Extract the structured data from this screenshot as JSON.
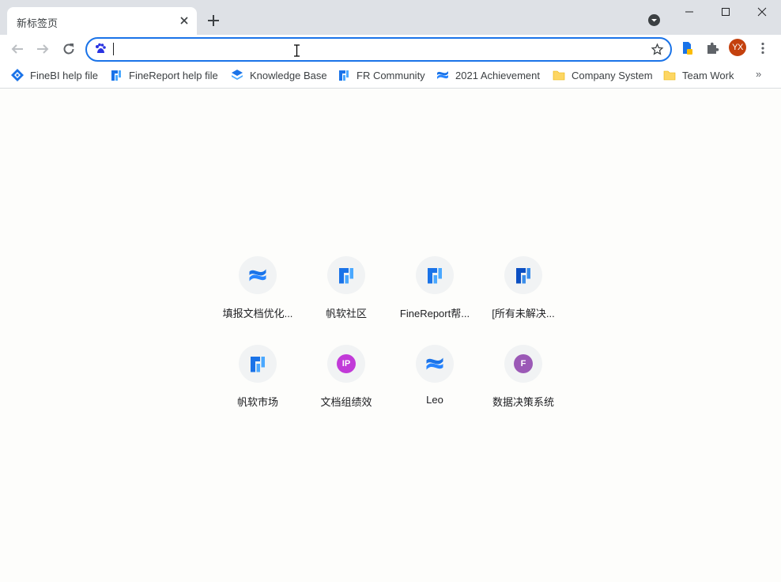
{
  "tab": {
    "title": "新标签页"
  },
  "omnibox": {
    "value": "",
    "placeholder": ""
  },
  "profile": {
    "initials": "YX",
    "color": "#c4410e"
  },
  "bookmarks": [
    {
      "label": "FineBI help file",
      "icon": "finebi-icon"
    },
    {
      "label": "FineReport help file",
      "icon": "finereport-icon"
    },
    {
      "label": "Knowledge Base",
      "icon": "stack-icon"
    },
    {
      "label": "FR Community",
      "icon": "finereport-icon"
    },
    {
      "label": "2021 Achievement",
      "icon": "confluence-icon"
    },
    {
      "label": "Company System",
      "icon": "folder-icon"
    },
    {
      "label": "Team Work",
      "icon": "folder-icon"
    }
  ],
  "bookmarks_more": "»",
  "shortcuts": [
    {
      "label": "填报文档优化...",
      "icon": "confluence-icon"
    },
    {
      "label": "帆软社区",
      "icon": "finereport-icon"
    },
    {
      "label": "FineReport帮...",
      "icon": "finereport-icon"
    },
    {
      "label": "[所有未解决...",
      "icon": "finereport-dark-icon"
    },
    {
      "label": "帆软市场",
      "icon": "finereport-icon"
    },
    {
      "label": "文档组绩效",
      "icon": "letter-icon",
      "letter": "IP",
      "color": "#c13ad8"
    },
    {
      "label": "Leo",
      "icon": "confluence-icon"
    },
    {
      "label": "数据决策系统",
      "icon": "letter-icon",
      "letter": "F",
      "color": "#9b59b6"
    }
  ],
  "colors": {
    "accent": "#1a73e8",
    "tabstrip": "#dee1e6"
  }
}
